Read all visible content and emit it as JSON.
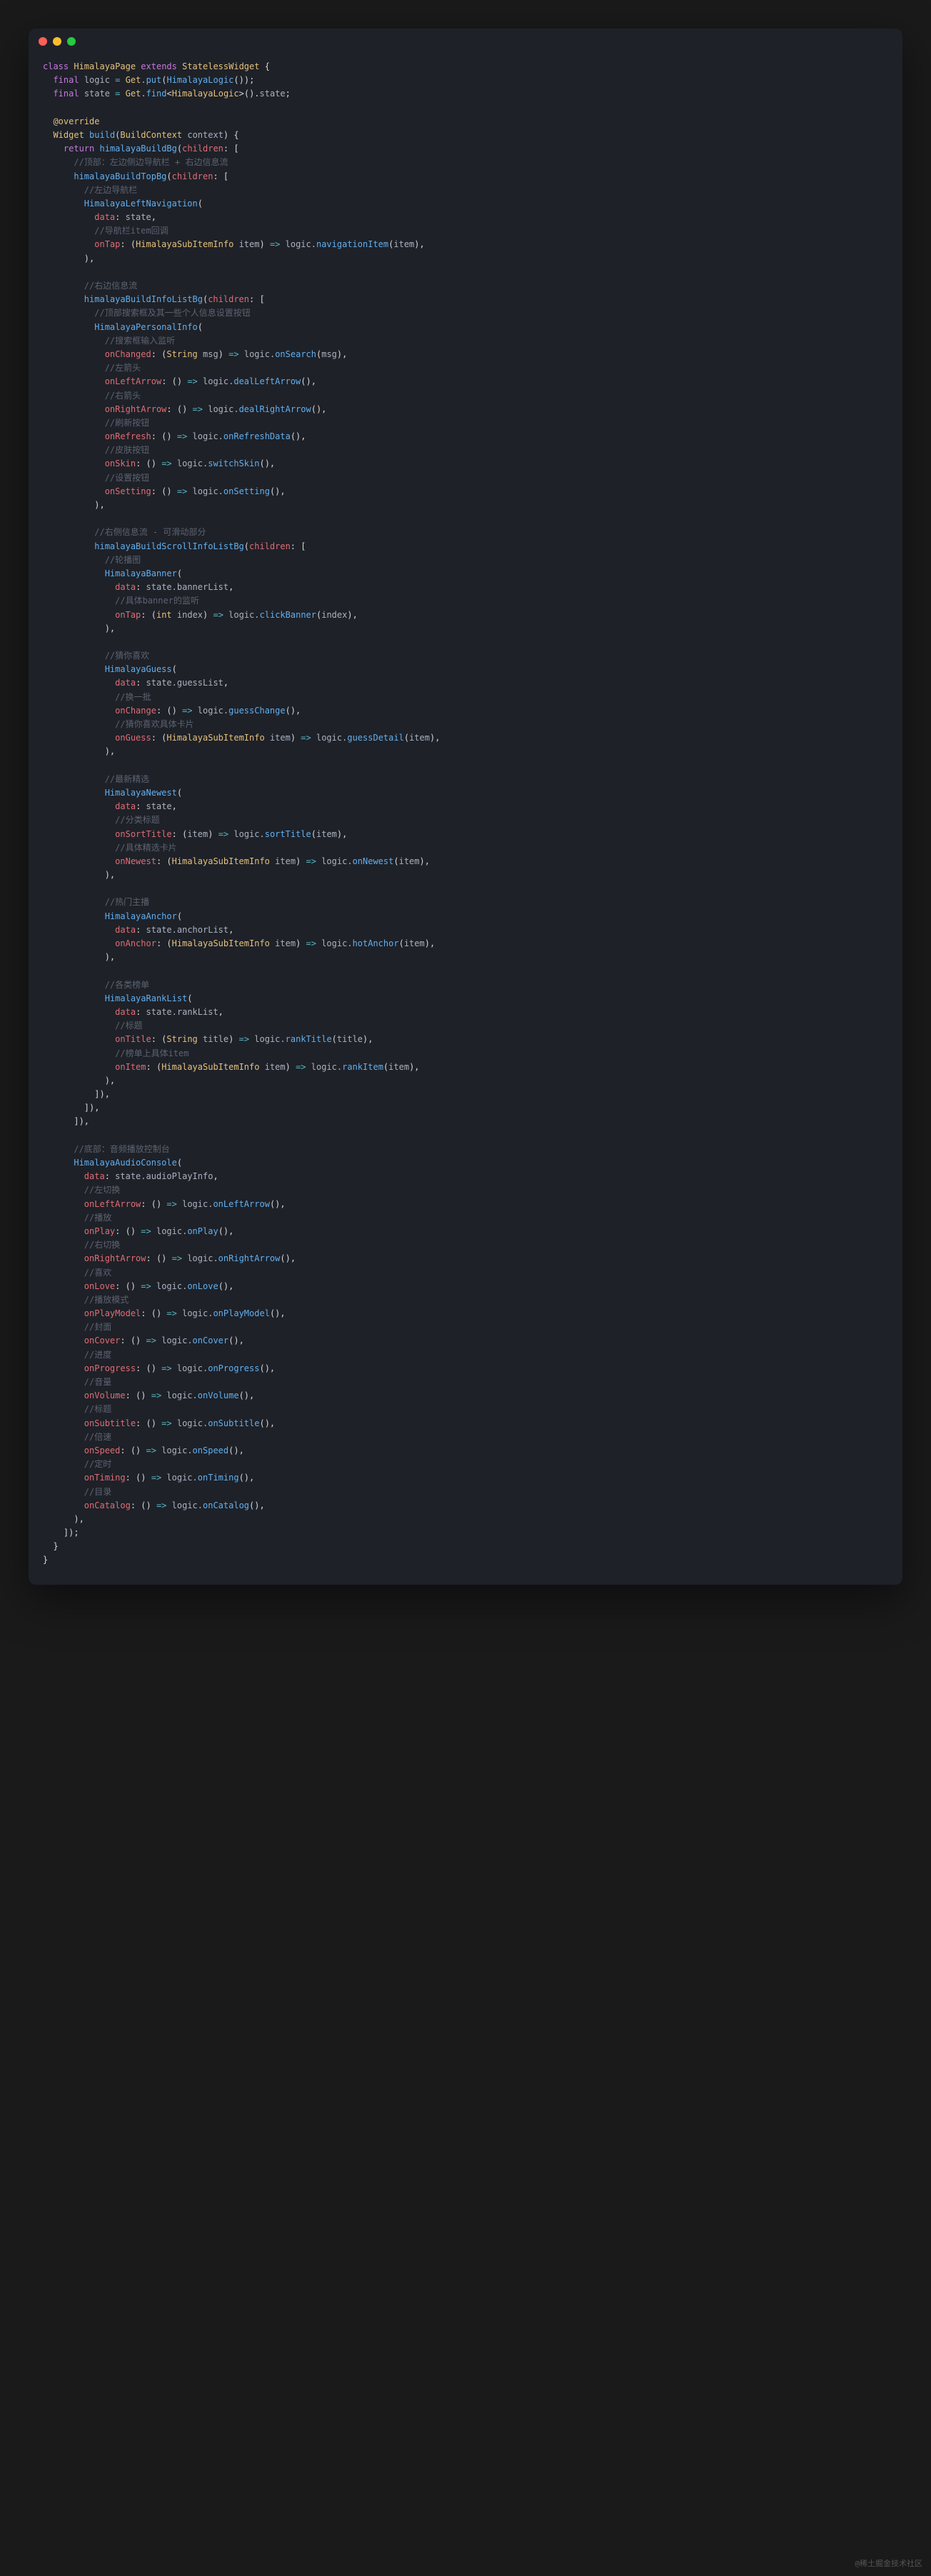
{
  "watermark": "@稀土掘金技术社区",
  "code": {
    "l1": "class",
    "l1b": "HimalayaPage",
    "l1c": "extends",
    "l1d": "StatelessWidget",
    "l2": "final",
    "l2b": "logic",
    "l2c": "Get",
    "l2d": "put",
    "l2e": "HimalayaLogic",
    "l3": "final",
    "l3b": "state",
    "l3c": "Get",
    "l3d": "find",
    "l3e": "HimalayaLogic",
    "l3f": "state",
    "l5": "@override",
    "l6a": "Widget",
    "l6b": "build",
    "l6c": "BuildContext",
    "l6d": "context",
    "l7a": "return",
    "l7b": "himalayaBuildBg",
    "l7c": "children",
    "c1": "//顶部：左边侧边导航栏 + 右边信息流",
    "l8a": "himalayaBuildTopBg",
    "l8b": "children",
    "c2": "//左边导航栏",
    "l9a": "HimalayaLeftNavigation",
    "l10a": "data",
    "l10b": "state",
    "c3": "//导航栏item回调",
    "l11a": "onTap",
    "l11b": "HimalayaSubItemInfo",
    "l11c": "item",
    "l11d": "logic",
    "l11e": "navigationItem",
    "l11f": "item",
    "c4": "//右边信息流",
    "l12a": "himalayaBuildInfoListBg",
    "l12b": "children",
    "c5": "//顶部搜索框及其一些个人信息设置按钮",
    "l13a": "HimalayaPersonalInfo",
    "c6": "//搜索框输入监听",
    "l14a": "onChanged",
    "l14b": "String",
    "l14c": "msg",
    "l14d": "logic",
    "l14e": "onSearch",
    "l14f": "msg",
    "c7": "//左箭头",
    "l15a": "onLeftArrow",
    "l15b": "logic",
    "l15c": "dealLeftArrow",
    "c8": "//右箭头",
    "l16a": "onRightArrow",
    "l16b": "logic",
    "l16c": "dealRightArrow",
    "c9": "//刷新按钮",
    "l17a": "onRefresh",
    "l17b": "logic",
    "l17c": "onRefreshData",
    "c10": "//皮肤按钮",
    "l18a": "onSkin",
    "l18b": "logic",
    "l18c": "switchSkin",
    "c11": "//设置按钮",
    "l19a": "onSetting",
    "l19b": "logic",
    "l19c": "onSetting",
    "c12": "//右侧信息流 - 可滑动部分",
    "l20a": "himalayaBuildScrollInfoListBg",
    "l20b": "children",
    "c13": "//轮播图",
    "l21a": "HimalayaBanner",
    "l22a": "data",
    "l22b": "state",
    "l22c": "bannerList",
    "c14": "//具体banner的监听",
    "l23a": "onTap",
    "l23b": "int",
    "l23c": "index",
    "l23d": "logic",
    "l23e": "clickBanner",
    "l23f": "index",
    "c15": "//猜你喜欢",
    "l24a": "HimalayaGuess",
    "l25a": "data",
    "l25b": "state",
    "l25c": "guessList",
    "c16": "//换一批",
    "l26a": "onChange",
    "l26b": "logic",
    "l26c": "guessChange",
    "c17": "//猜你喜欢具体卡片",
    "l27a": "onGuess",
    "l27b": "HimalayaSubItemInfo",
    "l27c": "item",
    "l27d": "logic",
    "l27e": "guessDetail",
    "l27f": "item",
    "c18": "//最新精选",
    "l28a": "HimalayaNewest",
    "l29a": "data",
    "l29b": "state",
    "c19": "//分类标题",
    "l30a": "onSortTitle",
    "l30b": "item",
    "l30c": "logic",
    "l30d": "sortTitle",
    "l30e": "item",
    "c20": "//具体精选卡片",
    "l31a": "onNewest",
    "l31b": "HimalayaSubItemInfo",
    "l31c": "item",
    "l31d": "logic",
    "l31e": "onNewest",
    "l31f": "item",
    "c21": "//热门主播",
    "l32a": "HimalayaAnchor",
    "l33a": "data",
    "l33b": "state",
    "l33c": "anchorList",
    "l34a": "onAnchor",
    "l34b": "HimalayaSubItemInfo",
    "l34c": "item",
    "l34d": "logic",
    "l34e": "hotAnchor",
    "l34f": "item",
    "c22": "//各类榜单",
    "l35a": "HimalayaRankList",
    "l36a": "data",
    "l36b": "state",
    "l36c": "rankList",
    "c23": "//标题",
    "l37a": "onTitle",
    "l37b": "String",
    "l37c": "title",
    "l37d": "logic",
    "l37e": "rankTitle",
    "l37f": "title",
    "c24": "//榜单上具体item",
    "l38a": "onItem",
    "l38b": "HimalayaSubItemInfo",
    "l38c": "item",
    "l38d": "logic",
    "l38e": "rankItem",
    "l38f": "item",
    "c25": "//底部：音频播放控制台",
    "l39a": "HimalayaAudioConsole",
    "l40a": "data",
    "l40b": "state",
    "l40c": "audioPlayInfo",
    "c26": "//左切换",
    "l41a": "onLeftArrow",
    "l41b": "logic",
    "l41c": "onLeftArrow",
    "c27": "//播放",
    "l42a": "onPlay",
    "l42b": "logic",
    "l42c": "onPlay",
    "c28": "//右切换",
    "l43a": "onRightArrow",
    "l43b": "logic",
    "l43c": "onRightArrow",
    "c29": "//喜欢",
    "l44a": "onLove",
    "l44b": "logic",
    "l44c": "onLove",
    "c30": "//播放模式",
    "l45a": "onPlayModel",
    "l45b": "logic",
    "l45c": "onPlayModel",
    "c31": "//封面",
    "l46a": "onCover",
    "l46b": "logic",
    "l46c": "onCover",
    "c32": "//进度",
    "l47a": "onProgress",
    "l47b": "logic",
    "l47c": "onProgress",
    "c33": "//音量",
    "l48a": "onVolume",
    "l48b": "logic",
    "l48c": "onVolume",
    "c34": "//标题",
    "l49a": "onSubtitle",
    "l49b": "logic",
    "l49c": "onSubtitle",
    "c35": "//倍速",
    "l50a": "onSpeed",
    "l50b": "logic",
    "l50c": "onSpeed",
    "c36": "//定时",
    "l51a": "onTiming",
    "l51b": "logic",
    "l51c": "onTiming",
    "c37": "//目录",
    "l52a": "onCatalog",
    "l52b": "logic",
    "l52c": "onCatalog"
  }
}
